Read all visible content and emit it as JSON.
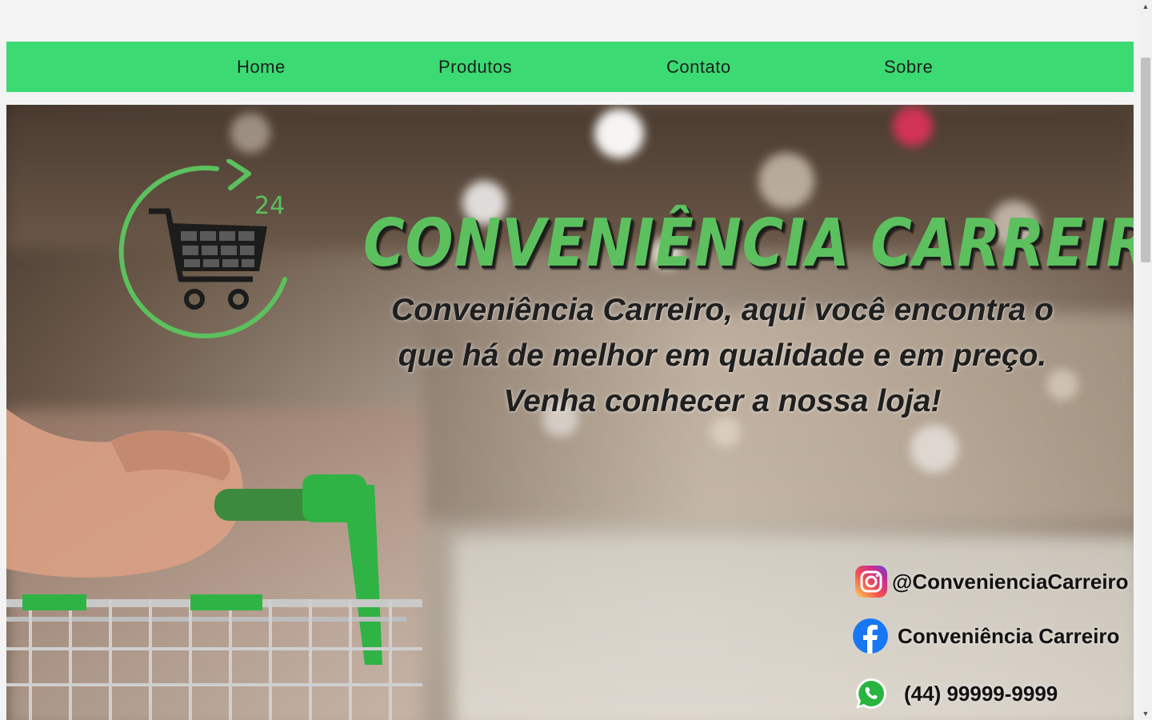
{
  "nav": {
    "items": [
      {
        "label": "Home"
      },
      {
        "label": "Produtos"
      },
      {
        "label": "Contato"
      },
      {
        "label": "Sobre"
      }
    ],
    "background": "#3bda72"
  },
  "hero": {
    "title": "Conveniência Carreiro",
    "tagline_lines": [
      "Conveniência Carreiro, aqui você encontra o",
      "que há de melhor em qualidade e em preço.",
      "Venha conhecer a nossa loja!"
    ],
    "logo": {
      "icon": "shopping-cart-24h-icon",
      "badge": "24"
    },
    "accent_color": "#5cc05e"
  },
  "contacts": {
    "instagram": {
      "icon": "instagram-icon",
      "text": "@ConvenienciaCarreiro"
    },
    "facebook": {
      "icon": "facebook-icon",
      "text": "Conveniência Carreiro"
    },
    "whatsapp": {
      "icon": "whatsapp-icon",
      "text": "(44) 99999-9999"
    }
  }
}
